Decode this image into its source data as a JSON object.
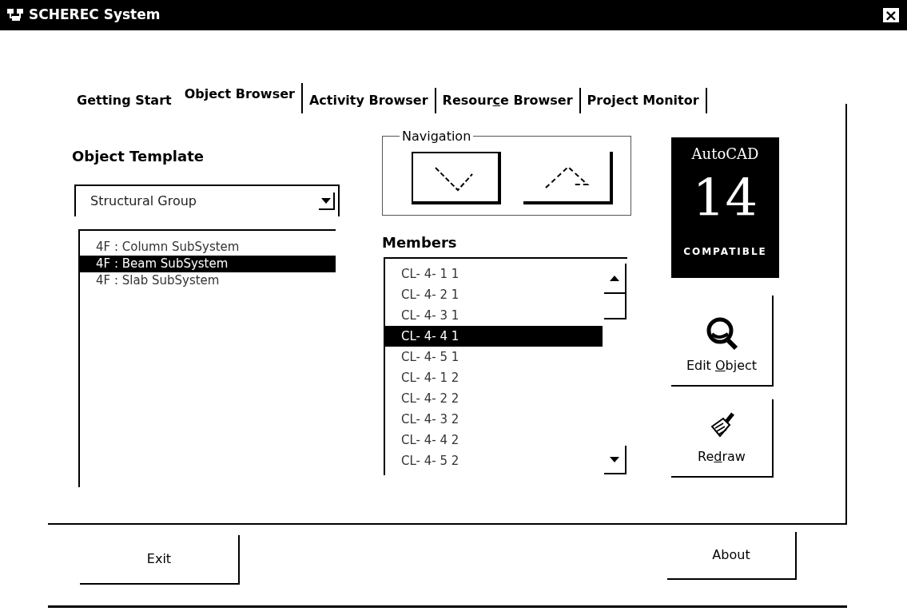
{
  "window": {
    "title": "SCHEREC System",
    "close": "×"
  },
  "tabs": [
    {
      "label": [
        {
          "text": "Getting Start"
        }
      ],
      "selected": false
    },
    {
      "label": [
        {
          "text": "Object Browser"
        }
      ],
      "selected": true
    },
    {
      "label": [
        {
          "text": "Activity Browser"
        }
      ],
      "selected": false
    },
    {
      "label": [
        {
          "text": "Resour"
        },
        {
          "text": "c",
          "underline": true
        },
        {
          "text": "e Browser"
        }
      ],
      "selected": false
    },
    {
      "label": [
        {
          "text": "Project Monitor"
        }
      ],
      "selected": false
    }
  ],
  "object_template": {
    "label": "Object Template",
    "dropdown": {
      "value": "Structural Group"
    },
    "items": [
      {
        "text": "4F : Column SubSystem",
        "selected": false
      },
      {
        "text": "4F : Beam SubSystem",
        "selected": true
      },
      {
        "text": "4F : Slab SubSystem",
        "selected": false
      }
    ]
  },
  "navigation": {
    "label": "Navigation"
  },
  "members": {
    "label": "Members",
    "items": [
      {
        "text": "CL- 4- 1 1",
        "selected": false
      },
      {
        "text": "CL- 4- 2 1",
        "selected": false
      },
      {
        "text": "CL- 4- 3 1",
        "selected": false
      },
      {
        "text": "CL- 4- 4 1",
        "selected": true
      },
      {
        "text": "CL- 4- 5 1",
        "selected": false
      },
      {
        "text": "CL- 4- 1 2",
        "selected": false
      },
      {
        "text": "CL- 4- 2 2",
        "selected": false
      },
      {
        "text": "CL- 4- 3 2",
        "selected": false
      },
      {
        "text": "CL- 4- 4 2",
        "selected": false
      },
      {
        "text": "CL- 4- 5 2",
        "selected": false
      }
    ]
  },
  "logo": {
    "brand": "AutoCAD",
    "version": "14",
    "tagline": "COMPATIBLE"
  },
  "side_buttons": [
    {
      "kind": "edit",
      "label": [
        {
          "text": "Edit "
        },
        {
          "text": "O",
          "underline": true
        },
        {
          "text": "bject"
        }
      ]
    },
    {
      "kind": "redraw",
      "label": [
        {
          "text": "Re"
        },
        {
          "text": "d",
          "underline": true
        },
        {
          "text": "raw"
        }
      ]
    }
  ],
  "footer_buttons": [
    "Exit",
    "About"
  ]
}
